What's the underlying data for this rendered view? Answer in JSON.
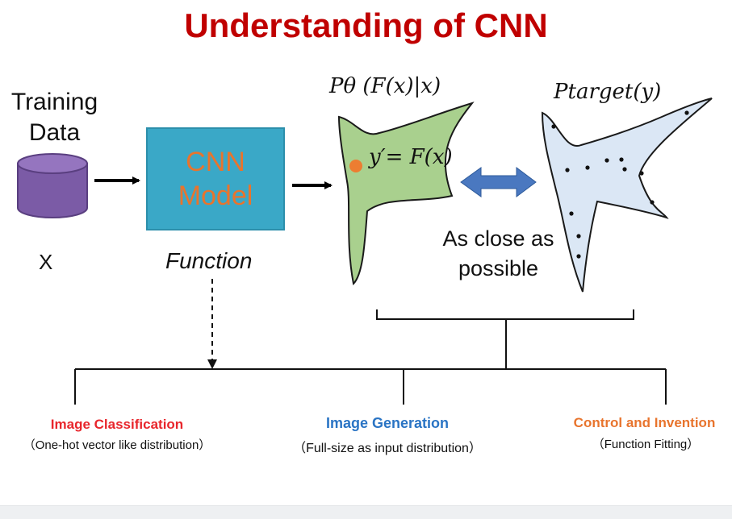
{
  "title": "Understanding of CNN",
  "input": {
    "label_line1": "Training",
    "label_line2": "Data",
    "variable": "X"
  },
  "model": {
    "line1": "CNN",
    "line2": "Model",
    "caption": "Function"
  },
  "distributions": {
    "model_label": "Pθ (F(x)|x)",
    "point_label": "y′= F(x)",
    "target_label": "Ptarget(y)",
    "comparison_line1": "As close as",
    "comparison_line2": "possible"
  },
  "applications": [
    {
      "title": "Image Classification",
      "subtitle": "（One-hot vector like distribution）"
    },
    {
      "title": "Image Generation",
      "subtitle": "（Full-size as input distribution）"
    },
    {
      "title": "Control and Invention",
      "subtitle": "（Function Fitting）"
    }
  ],
  "colors": {
    "title": "#c00000",
    "cylinder": "#7b5ba6",
    "model_box": "#3aa8c7",
    "model_text": "#e8742d",
    "model_distribution": "#a9d08e",
    "target_distribution": "#dbe7f5",
    "double_arrow": "#4a78c0",
    "point": "#ed7d31",
    "classification": "#e8262c",
    "generation": "#2a74c4",
    "control": "#e8742d"
  }
}
